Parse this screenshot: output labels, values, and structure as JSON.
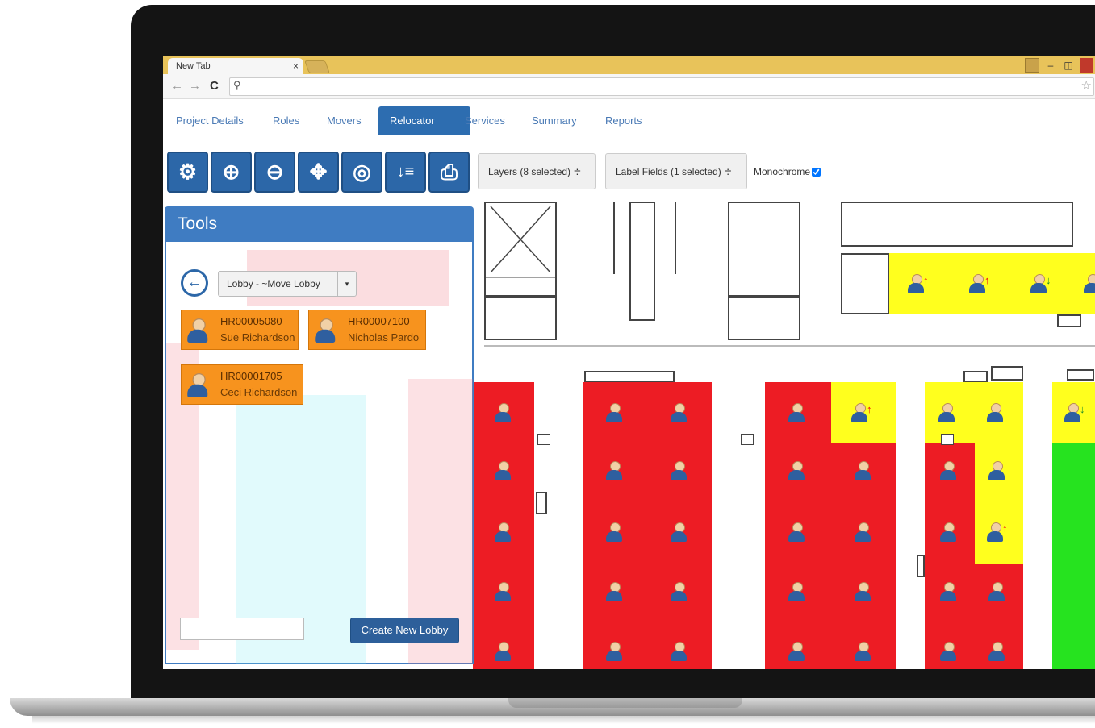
{
  "browser": {
    "tab_title": "New Tab",
    "tab_close": "×",
    "back_glyph": "←",
    "forward_glyph": "→",
    "reload_glyph": "C",
    "search_glyph": "⚲",
    "bookmark_glyph": "☆",
    "win_min": "–",
    "win_max": "◫"
  },
  "nav": {
    "items": [
      {
        "label": "Project Details"
      },
      {
        "label": "Roles"
      },
      {
        "label": "Movers"
      },
      {
        "label": "Relocator",
        "active": true
      },
      {
        "label": "Services"
      },
      {
        "label": "Summary"
      },
      {
        "label": "Reports"
      }
    ]
  },
  "toolbar": {
    "icons": [
      "settings-icon",
      "zoom-in-icon",
      "zoom-out-icon",
      "fit-extents-icon",
      "zoom-window-icon",
      "sort-icon",
      "print-icon"
    ],
    "glyphs": [
      "⚙",
      "⊕",
      "⊖",
      "✥",
      "◎",
      "↓≡",
      "⎙"
    ],
    "layers_label": "Layers (8 selected) ≑",
    "label_fields_label": "Label Fields (1 selected) ≑",
    "monochrome_label": "Monochrome",
    "monochrome_checked": true
  },
  "tools": {
    "title": "Tools",
    "back_glyph": "←",
    "lobby_value": "Lobby - ~Move Lobby",
    "lobby_caret": "▾",
    "people": [
      {
        "id": "HR00005080",
        "name": "Sue Richardson"
      },
      {
        "id": "HR00007100",
        "name": "Nicholas Pardo"
      },
      {
        "id": "HR00001705",
        "name": "Ceci Richardson"
      }
    ],
    "new_lobby_placeholder": "",
    "create_label": "Create New Lobby"
  },
  "colors": {
    "occupied": "#ed1c24",
    "moving": "#ffff1e",
    "vacant": "#26e31f",
    "accent": "#2c67a8",
    "lobby_card": "#f7931e"
  }
}
